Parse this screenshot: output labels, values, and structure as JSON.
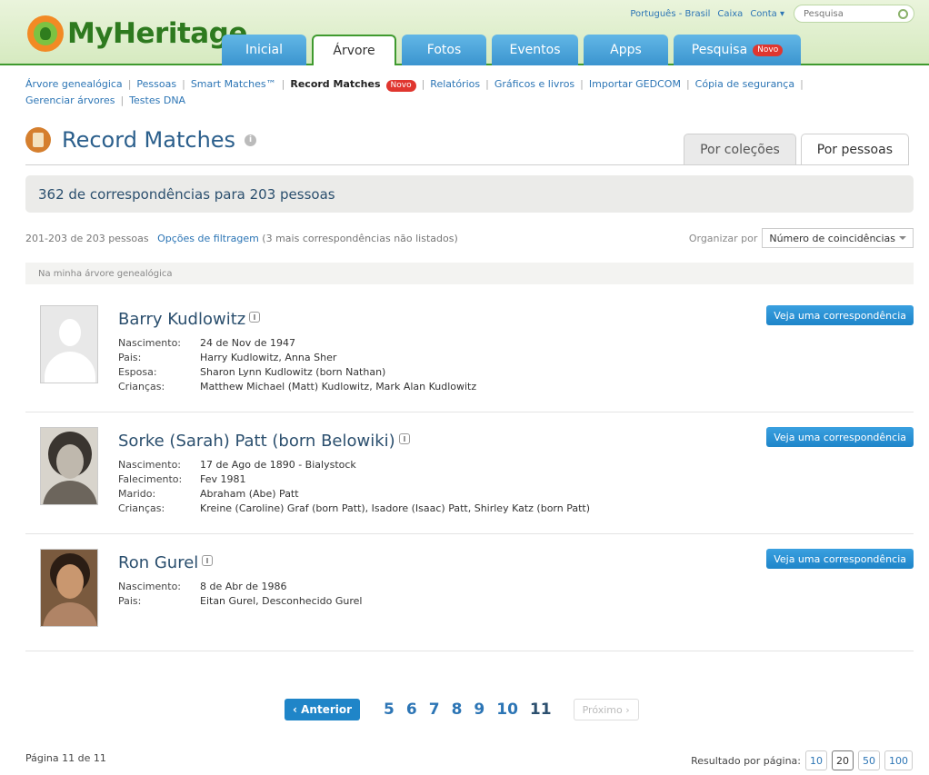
{
  "header": {
    "logo": "MyHeritage",
    "top_links": [
      "Português - Brasil",
      "Caixa",
      "Conta ▾"
    ],
    "search_placeholder": "Pesquisa",
    "tabs": [
      {
        "label": "Inicial"
      },
      {
        "label": "Árvore"
      },
      {
        "label": "Fotos"
      },
      {
        "label": "Eventos"
      },
      {
        "label": "Apps"
      },
      {
        "label": "Pesquisa",
        "badge": "Novo"
      }
    ]
  },
  "subnav": {
    "items": [
      "Árvore genealógica",
      "Pessoas",
      "Smart Matches™",
      "Record Matches",
      "Relatórios",
      "Gráficos e livros",
      "Importar GEDCOM",
      "Cópia de segurança",
      "Gerenciar árvores",
      "Testes DNA"
    ],
    "badge": "Novo"
  },
  "page": {
    "title": "Record Matches",
    "view_tabs": [
      "Por coleções",
      "Por pessoas"
    ],
    "summary": "362 de correspondências para 203 pessoas",
    "range": "201-203 de 203 pessoas",
    "filter_link": "Opções de filtragem",
    "filter_note": "(3 mais correspondências não listados)",
    "sort_label": "Organizar por",
    "sort_value": "Número de coincidências",
    "section": "Na minha árvore genealógica"
  },
  "people": [
    {
      "name": "Barry Kudlowitz",
      "button": "Veja uma correspondência",
      "facts": [
        {
          "label": "Nascimento:",
          "value": "24 de Nov de 1947"
        },
        {
          "label": "Pais:",
          "value": "Harry Kudlowitz, Anna Sher"
        },
        {
          "label": "Esposa:",
          "value": "Sharon Lynn Kudlowitz (born Nathan)"
        },
        {
          "label": "Crianças:",
          "value": "Matthew Michael (Matt) Kudlowitz, Mark Alan Kudlowitz"
        }
      ]
    },
    {
      "name": "Sorke (Sarah) Patt (born Belowiki)",
      "button": "Veja uma correspondência",
      "facts": [
        {
          "label": "Nascimento:",
          "value": "17 de Ago de 1890 - Bialystock"
        },
        {
          "label": "Falecimento:",
          "value": "Fev 1981"
        },
        {
          "label": "Marido:",
          "value": "Abraham (Abe) Patt"
        },
        {
          "label": "Crianças:",
          "value": "Kreine (Caroline) Graf (born Patt), Isadore (Isaac) Patt, Shirley Katz (born Patt)"
        }
      ]
    },
    {
      "name": "Ron Gurel",
      "button": "Veja uma correspondência",
      "facts": [
        {
          "label": "Nascimento:",
          "value": "8 de Abr de 1986"
        },
        {
          "label": "Pais:",
          "value": "Eitan Gurel, Desconhecido Gurel"
        }
      ]
    }
  ],
  "pagination": {
    "prev": "Anterior",
    "pages": [
      "5",
      "6",
      "7",
      "8",
      "9",
      "10",
      "11"
    ],
    "current": "11",
    "next": "Próximo",
    "footer": "Página 11 de 11",
    "per_page_label": "Resultado por página:",
    "per_page_options": [
      "10",
      "20",
      "50",
      "100"
    ],
    "per_page_current": "20"
  },
  "colors": {
    "brand_green": "#3f9a2f",
    "tab_blue": "#3b94cf",
    "link": "#2c75b5",
    "badge": "#e0362f"
  }
}
